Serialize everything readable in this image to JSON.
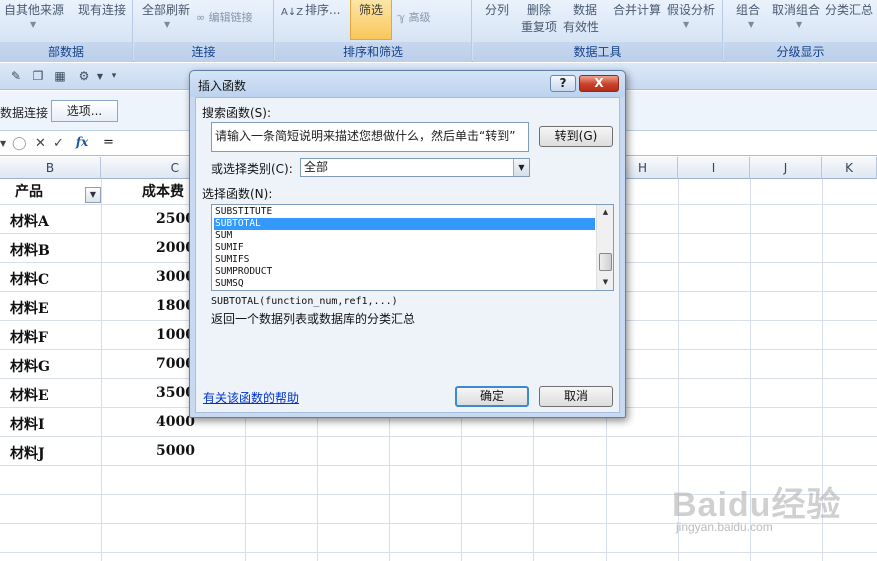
{
  "ribbon": {
    "group_labels": [
      "部数据",
      "连接",
      "排序和筛选",
      "数据工具",
      "分级显示"
    ],
    "get_external_other": "自其他来源",
    "existing_connections": "现有连接",
    "refresh_all": "全部刷新",
    "edit_links": "编辑链接",
    "sort_az": "A↓Z",
    "sort": "排序...",
    "filter": "筛选",
    "advanced": "高级",
    "text_to_columns": "分列",
    "remove_duplicates": "删除\n重复项",
    "remove_dup_line1": "删除",
    "remove_dup_line2": "重复项",
    "data_validation_line1": "数据",
    "data_validation_line2": "有效性",
    "consolidate": "合并计算",
    "what_if": "假设分析",
    "group": "组合",
    "ungroup": "取消组合",
    "subtotal": "分类汇总"
  },
  "security_bar": {
    "label": "数据连接",
    "options_button": "选项..."
  },
  "formula_bar": {
    "formula": "="
  },
  "sheet": {
    "columns": [
      "B",
      "C",
      "H",
      "I",
      "J",
      "K"
    ],
    "header_product": "产品",
    "header_cost": "成本费",
    "products": [
      "材料A",
      "材料B",
      "材料C",
      "材料E",
      "材料F",
      "材料G",
      "材料E",
      "材料I",
      "材料J"
    ],
    "costs": [
      "2500",
      "2000",
      "3000",
      "1800",
      "1000",
      "7000",
      "3500",
      "4000",
      "5000"
    ]
  },
  "dialog": {
    "title": "插入函数",
    "help_button": "?",
    "close_button": "X",
    "search_label": "搜索函数(S):",
    "search_placeholder": "请输入一条简短说明来描述您想做什么，然后单击“转到”",
    "go_button": "转到(G)",
    "category_label": "或选择类别(C):",
    "category_value": "全部",
    "function_label": "选择函数(N):",
    "functions": [
      "SUBSTITUTE",
      "SUBTOTAL",
      "SUM",
      "SUMIF",
      "SUMIFS",
      "SUMPRODUCT",
      "SUMSQ"
    ],
    "selected_index": 1,
    "syntax": "SUBTOTAL(function_num,ref1,...)",
    "description": "返回一个数据列表或数据库的分类汇总",
    "help_link": "有关该函数的帮助",
    "ok_button": "确定",
    "cancel_button": "取消"
  },
  "watermark": {
    "main": "Baidu经验",
    "sub": "jingyan.baidu.com"
  }
}
